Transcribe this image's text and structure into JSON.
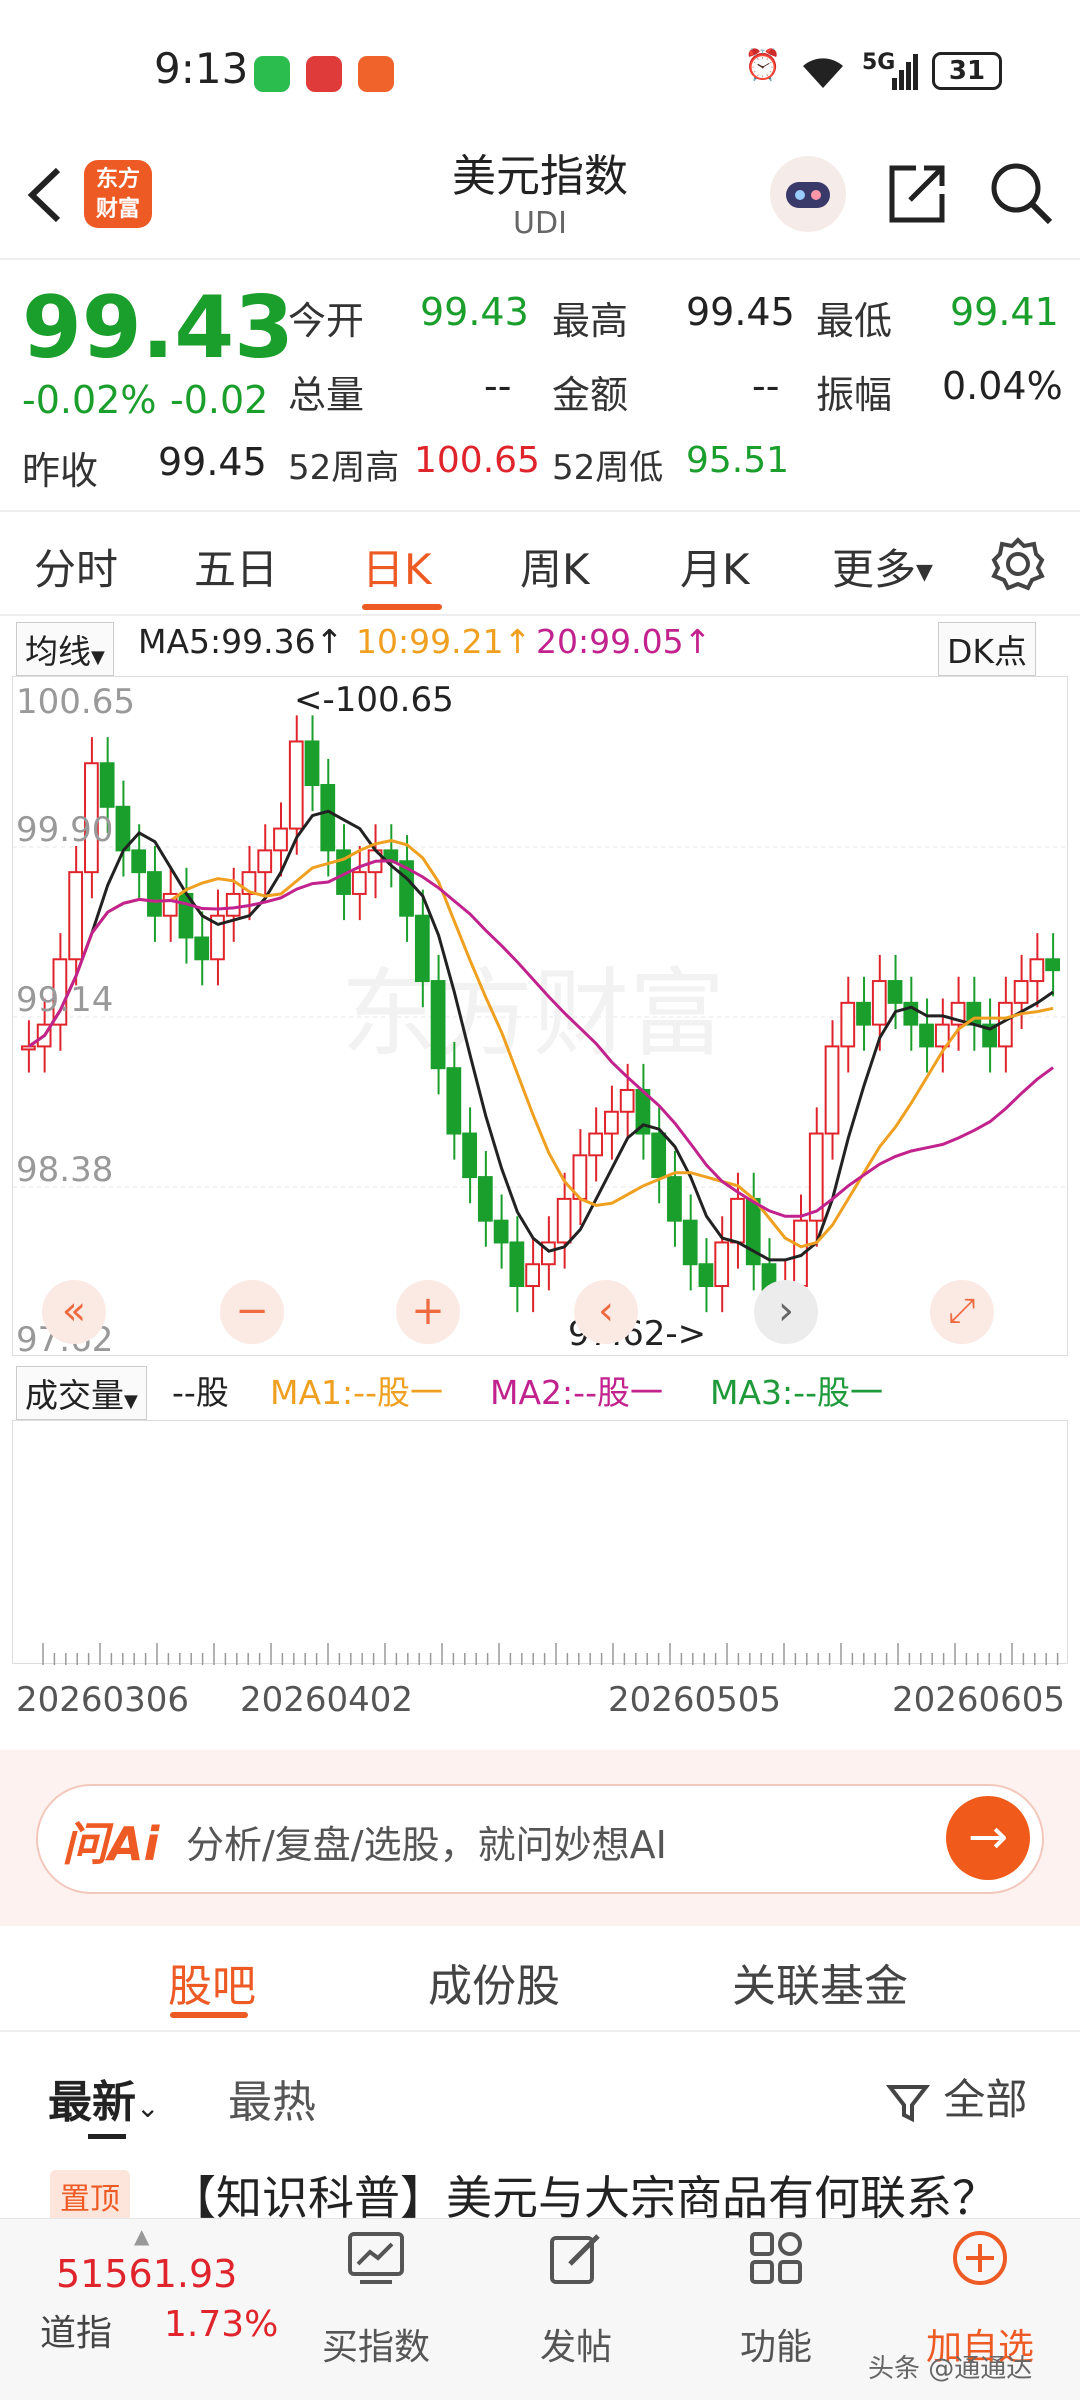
{
  "status_bar": {
    "time": "9:13",
    "network": "5G",
    "battery": "31"
  },
  "header": {
    "logo_text": "东方财富",
    "title": "美元指数",
    "subtitle": "UDI"
  },
  "quote": {
    "price": "99.43",
    "change_pct": "-0.02%",
    "change": "-0.02",
    "open_label": "今开",
    "open": "99.43",
    "high_label": "最高",
    "high": "99.45",
    "low_label": "最低",
    "low": "99.41",
    "volume_label": "总量",
    "volume": "--",
    "amount_label": "金额",
    "amount": "--",
    "amplitude_label": "振幅",
    "amplitude": "0.04%",
    "prev_close_label": "昨收",
    "prev_close": "99.45",
    "w52_high_label": "52周高",
    "w52_high": "100.65",
    "w52_low_label": "52周低",
    "w52_low": "95.51"
  },
  "tabs": [
    {
      "label": "分时",
      "active": false
    },
    {
      "label": "五日",
      "active": false
    },
    {
      "label": "日K",
      "active": true
    },
    {
      "label": "周K",
      "active": false
    },
    {
      "label": "月K",
      "active": false
    },
    {
      "label": "更多",
      "active": false
    }
  ],
  "indicators": {
    "selector": "均线",
    "ma5": "MA5:99.36↑",
    "ma10": "10:99.21↑",
    "ma20": "20:99.05↑",
    "dk": "DK点"
  },
  "chart": {
    "y_labels": [
      "100.65",
      "99.90",
      "99.14",
      "98.38",
      "97.62"
    ],
    "max_annotation": "<-100.65",
    "min_annotation": "97.62->",
    "watermark": "东方财富",
    "x_labels": [
      "20260306",
      "20260402",
      "20260505",
      "20260605"
    ]
  },
  "volume": {
    "selector": "成交量",
    "unit": "--股",
    "ma1": "MA1:--股一",
    "ma2": "MA2:--股一",
    "ma3": "MA3:--股一"
  },
  "ai": {
    "logo": "问Ai",
    "placeholder": "分析/复盘/选股，就问妙想AI"
  },
  "community_tabs": [
    "股吧",
    "成份股",
    "关联基金"
  ],
  "sub_tabs": {
    "latest": "最新",
    "hot": "最热",
    "all": "全部"
  },
  "pinned": {
    "badge": "置顶",
    "title": "【知识科普】美元与大宗商品有何联系？"
  },
  "bottom_nav": {
    "index_value": "51561.93",
    "index_name": "道指",
    "index_change": "1.73%",
    "items": [
      "买指数",
      "发帖",
      "功能",
      "加自选"
    ]
  },
  "watermark_corner": "头条 @通通达",
  "colors": {
    "accent": "#ee5a24",
    "up": "#e0242b",
    "down": "#1a9e2c",
    "ma10": "#f0a020",
    "ma20": "#c2228d"
  }
}
